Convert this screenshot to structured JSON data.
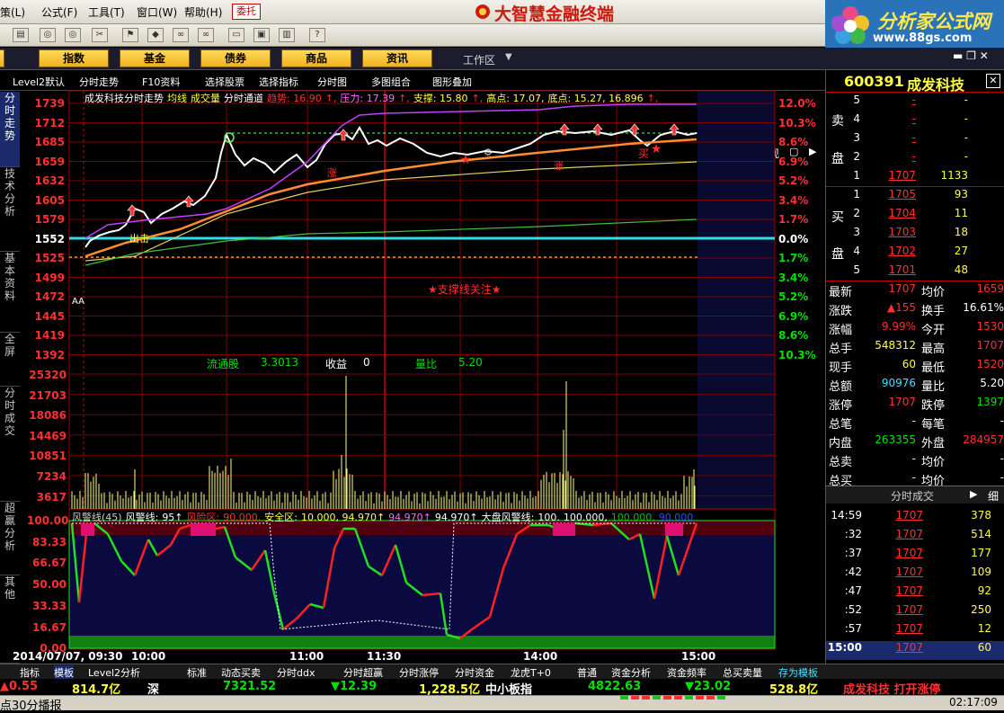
{
  "menu": {
    "items": [
      "策(L)",
      "公式(F)",
      "工具(T)",
      "窗口(W)",
      "帮助(H)"
    ],
    "weituo": "委托",
    "title": "大智慧金融终端",
    "logo": "分析家公式网",
    "logo_url": "www.88gs.com"
  },
  "categories": [
    "股",
    "指数",
    "基金",
    "债券",
    "商品",
    "资讯"
  ],
  "workspace": "工作区",
  "subbar": {
    "items": [
      "Level2默认",
      "分时走势",
      "F10资料",
      "选择股票",
      "选择指标",
      "分时图",
      "多图组合",
      "图形叠加"
    ],
    "mark": "标",
    "live": "现"
  },
  "left_tabs": [
    "分时走势",
    "技术分析",
    "基本资料",
    "全屏",
    "分时成交",
    "超赢分析",
    "其他"
  ],
  "chart": {
    "legend": [
      {
        "t": "成发科技分时走势",
        "c": "#ffffff"
      },
      {
        "t": "均线",
        "c": "#ffff40"
      },
      {
        "t": "成交量",
        "c": "#ffff40"
      },
      {
        "t": "分时通道",
        "c": "#ffffff"
      },
      {
        "t": "趋势: 16.90",
        "c": "#ff3030"
      },
      {
        "t": "↑,",
        "c": "#ff3030"
      },
      {
        "t": "压力: 17.39",
        "c": "#ff66ff"
      },
      {
        "t": "↑,",
        "c": "#ff3030"
      },
      {
        "t": "支撑: 15.80",
        "c": "#ffff40"
      },
      {
        "t": "↑,",
        "c": "#ff3030"
      },
      {
        "t": "高点: 17.07,",
        "c": "#ffff40"
      },
      {
        "t": "底点: 15.27, 16.896",
        "c": "#ffff40"
      },
      {
        "t": "↑,",
        "c": "#ff3030"
      }
    ],
    "price_axis": [
      "1739",
      "1712",
      "1685",
      "1659",
      "1632",
      "1605",
      "1579",
      "1552",
      "1525",
      "1499",
      "1472",
      "1445",
      "1419",
      "1392"
    ],
    "pct_axis": [
      "12.0%",
      "10.3%",
      "8.6%",
      "6.9%",
      "5.2%",
      "3.4%",
      "1.7%",
      "0.0%",
      "1.7%",
      "3.4%",
      "5.2%",
      "6.9%",
      "8.6%",
      "10.3%"
    ],
    "vol_axis": [
      "25320",
      "21703",
      "18086",
      "14469",
      "10851",
      "7234",
      "3617"
    ],
    "warn_axis": [
      "100.00",
      "83.33",
      "66.67",
      "50.00",
      "33.33",
      "16.67",
      "0.00"
    ],
    "time_axis": [
      "2014/07/07, 09:30",
      "10:00",
      "11:00",
      "11:30",
      "14:00",
      "15:00"
    ],
    "support_note": "★支撑线关注★",
    "aa": "AA",
    "stats": {
      "l1": "流通股",
      "v1": "3.3013",
      "l2": "收益",
      "v2": "0",
      "l3": "量比",
      "v3": "5.20"
    },
    "buy_mark": "买",
    "rise_mark": "涨",
    "chu_mark": "出击",
    "warn_legend": [
      {
        "t": "风警线(45)",
        "c": "#cccccc"
      },
      {
        "t": "风警线:",
        "c": "#ffffff"
      },
      {
        "t": "95↑",
        "c": "#ffffff"
      },
      {
        "t": "风险区:",
        "c": "#ff3030"
      },
      {
        "t": "90.000,",
        "c": "#ff3030"
      },
      {
        "t": "安全区:",
        "c": "#ffff40"
      },
      {
        "t": "10.000, 94.970↑",
        "c": "#ffff40"
      },
      {
        "t": "94.970↑",
        "c": "#ff66ff"
      },
      {
        "t": "94.970↑",
        "c": "#ffffff"
      },
      {
        "t": "大盘风警线:",
        "c": "#ffffff"
      },
      {
        "t": "100.",
        "c": "#ffffff"
      },
      {
        "t": "100.000,",
        "c": "#ffffff"
      },
      {
        "t": "100.000,",
        "c": "#00c000"
      },
      {
        "t": "90.000",
        "c": "#2050ff"
      }
    ]
  },
  "chart_data": {
    "type": "line",
    "title": "成发科技分时走势",
    "x": [
      "09:30",
      "10:00",
      "11:00",
      "11:30",
      "14:00",
      "15:00"
    ],
    "series": [
      {
        "name": "分时走势",
        "values": [
          1552,
          1605,
          1685,
          1712,
          1659,
          1707
        ]
      },
      {
        "name": "均线",
        "values": [
          1552,
          1579,
          1632,
          1645,
          1659,
          1685
        ]
      }
    ],
    "ylim": [
      1392,
      1739
    ]
  },
  "stock": {
    "code": "600391",
    "name": "成发科技",
    "sell_lbl": [
      "卖",
      "盘"
    ],
    "buy_lbl": [
      "买",
      "盘"
    ],
    "asks": [
      {
        "n": "5",
        "p": "-",
        "v": "-"
      },
      {
        "n": "4",
        "p": "-",
        "v": "-"
      },
      {
        "n": "3",
        "p": "-",
        "v": "-"
      },
      {
        "n": "2",
        "p": "-",
        "v": "-"
      },
      {
        "n": "1",
        "p": "1707",
        "v": "1133"
      }
    ],
    "bids": [
      {
        "n": "1",
        "p": "1705",
        "v": "93"
      },
      {
        "n": "2",
        "p": "1704",
        "v": "11"
      },
      {
        "n": "3",
        "p": "1703",
        "v": "18"
      },
      {
        "n": "4",
        "p": "1702",
        "v": "27"
      },
      {
        "n": "5",
        "p": "1701",
        "v": "48"
      }
    ],
    "quote": [
      {
        "l": "最新",
        "v": "1707",
        "vc": "#ff3030",
        "l2": "均价",
        "v2": "1659",
        "v2c": "#ff3030"
      },
      {
        "l": "涨跌",
        "v": "▲155",
        "vc": "#ff3030",
        "l2": "换手",
        "v2": "16.61%",
        "v2c": "#ffffff"
      },
      {
        "l": "涨幅",
        "v": "9.99%",
        "vc": "#ff3030",
        "l2": "今开",
        "v2": "1530",
        "v2c": "#ff3030"
      },
      {
        "l": "总手",
        "v": "548312",
        "vc": "#ffff40",
        "l2": "最高",
        "v2": "1707",
        "v2c": "#ff3030"
      },
      {
        "l": "现手",
        "v": "60",
        "vc": "#ffff40",
        "l2": "最低",
        "v2": "1520",
        "v2c": "#ff3030"
      },
      {
        "l": "总额",
        "v": "90976",
        "vc": "#40e0ff",
        "l2": "量比",
        "v2": "5.20",
        "v2c": "#ffffff"
      },
      {
        "l": "涨停",
        "v": "1707",
        "vc": "#ff3030",
        "l2": "跌停",
        "v2": "1397",
        "v2c": "#00e000"
      },
      {
        "l": "总笔",
        "v": "-",
        "vc": "#ffffff",
        "l2": "每笔",
        "v2": "-",
        "v2c": "#ffffff"
      },
      {
        "l": "内盘",
        "v": "263355",
        "vc": "#00e000",
        "l2": "外盘",
        "v2": "284957",
        "v2c": "#ff3030"
      },
      {
        "l": "总卖",
        "v": "-",
        "vc": "#ffffff",
        "l2": "均价",
        "v2": "-",
        "v2c": "#ffffff"
      },
      {
        "l": "总买",
        "v": "-",
        "vc": "#ffffff",
        "l2": "均价",
        "v2": "-",
        "v2c": "#ffffff"
      }
    ],
    "ticks_title": "分时成交",
    "ticks_btn": "细",
    "ticks": [
      {
        "t": "14:59",
        "p": "1707",
        "v": "378"
      },
      {
        "t": ":32",
        "p": "1707",
        "v": "514"
      },
      {
        "t": ":37",
        "p": "1707",
        "v": "177"
      },
      {
        "t": ":42",
        "p": "1707",
        "v": "109"
      },
      {
        "t": ":47",
        "p": "1707",
        "v": "92"
      },
      {
        "t": ":52",
        "p": "1707",
        "v": "250"
      },
      {
        "t": ":57",
        "p": "1707",
        "v": "12"
      },
      {
        "t": "15:00",
        "p": "1707",
        "v": "60"
      }
    ],
    "tabs": [
      "分笔",
      "财务",
      "分价",
      "指数",
      "资讯",
      "短线"
    ]
  },
  "bottom_tabs": [
    "指标",
    "模板",
    "Level2分析",
    "标准",
    "动态买卖",
    "分时ddx",
    "分时超赢",
    "分时涨停",
    "分时资金",
    "龙虎T+0",
    "普通",
    "资金分析",
    "资金频率",
    "总买卖量",
    "存为模板"
  ],
  "status": [
    {
      "t": "▲0.55",
      "c": "#ff3030"
    },
    {
      "t": "814.7亿",
      "c": "#ffff40"
    },
    {
      "t": "深",
      "c": "#ffffff"
    },
    {
      "t": "7321.52",
      "c": "#00e000"
    },
    {
      "t": "▼12.39",
      "c": "#00e000"
    },
    {
      "t": "1,228.5亿",
      "c": "#ffff40"
    },
    {
      "t": "中小板指",
      "c": "#ffffff"
    },
    {
      "t": "4822.63",
      "c": "#00e000"
    },
    {
      "t": "▼23.02",
      "c": "#00e000"
    },
    {
      "t": "528.8亿",
      "c": "#ffff40"
    },
    {
      "t": "成发科技 打开涨停",
      "c": "#ff3030"
    }
  ],
  "ticker": {
    "text": "点30分播报",
    "time": "02:17:09"
  }
}
